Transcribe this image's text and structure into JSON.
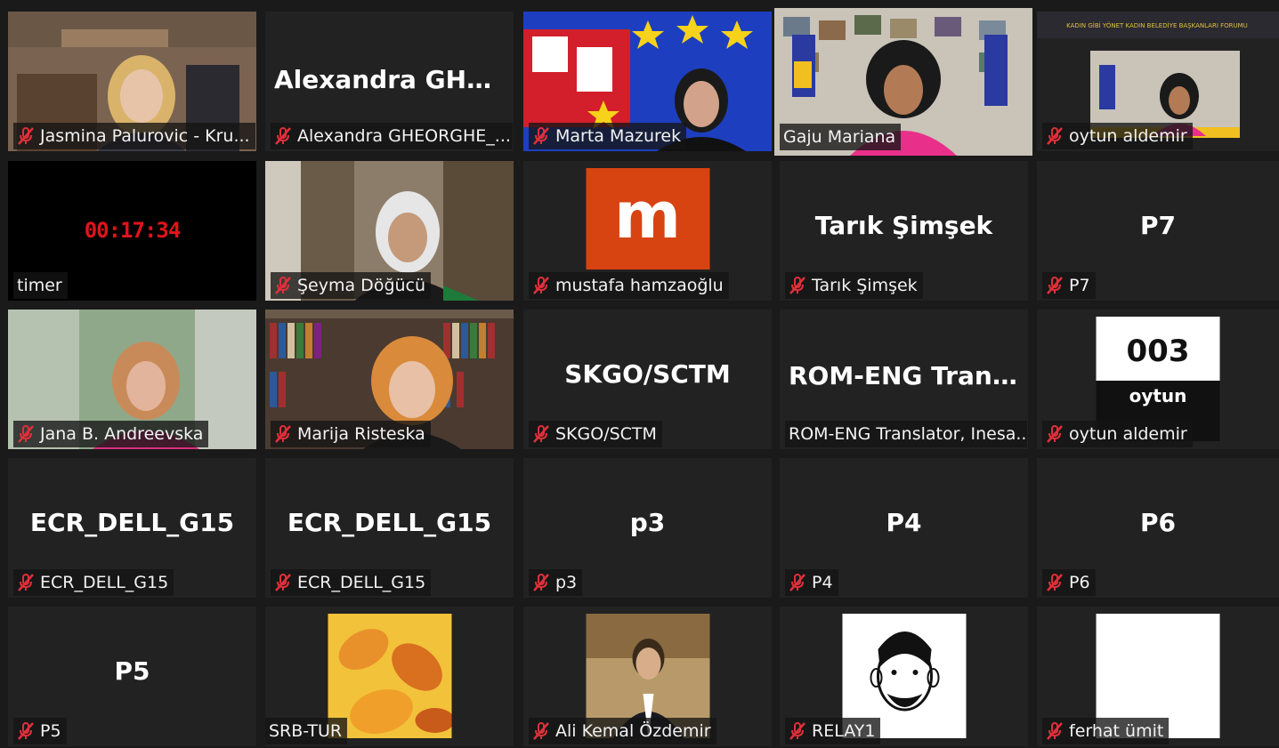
{
  "colors": {
    "background": "#1a1a1a",
    "tile": "#222222",
    "active_border": "#e3e07a",
    "mute_icon": "#e0303a",
    "timer_red": "#e0141a",
    "avatar_orange": "#d84312"
  },
  "tiles": [
    {
      "label": "Jasmina Palurovic - Kru...",
      "muted": true
    },
    {
      "label": "Alexandra GHEORGHE_...",
      "big": "Alexandra  GHE...",
      "muted": true
    },
    {
      "label": "Marta Mazurek",
      "muted": true
    },
    {
      "label": "Gaju Mariana",
      "muted": false,
      "active": true
    },
    {
      "label": "oytun aldemir",
      "muted": true
    },
    {
      "label": "timer",
      "timer": "00:17:34",
      "muted": false
    },
    {
      "label": "Şeyma Döğücü",
      "muted": true
    },
    {
      "label": "mustafa hamzaoğlu",
      "avatar_letter": "m",
      "muted": true
    },
    {
      "label": "Tarık Şimşek",
      "big": "Tarık Şimşek",
      "muted": true
    },
    {
      "label": "P7",
      "big": "P7",
      "muted": true
    },
    {
      "label": "Jana B. Andreevska",
      "muted": true
    },
    {
      "label": "Marija Risteska",
      "muted": true
    },
    {
      "label": "SKGO/SCTM",
      "big": "SKGO/SCTM",
      "muted": true
    },
    {
      "label": "ROM-ENG Translator, Inesa...",
      "big": "ROM-ENG  Tran...",
      "muted": false
    },
    {
      "label": "oytun aldemir",
      "box_number": "003",
      "box_name": "oytun",
      "muted": true
    },
    {
      "label": "ECR_DELL_G15",
      "big": "ECR_DELL_G15",
      "muted": true
    },
    {
      "label": "ECR_DELL_G15",
      "big": "ECR_DELL_G15",
      "muted": true
    },
    {
      "label": "p3",
      "big": "p3",
      "muted": true
    },
    {
      "label": "P4",
      "big": "P4",
      "muted": true
    },
    {
      "label": "P6",
      "big": "P6",
      "muted": true
    },
    {
      "label": "P5",
      "big": "P5",
      "muted": true
    },
    {
      "label": "SRB-TUR",
      "muted": false
    },
    {
      "label": "Ali Kemal Özdemir",
      "muted": true
    },
    {
      "label": "RELAY1",
      "muted": true
    },
    {
      "label": "ferhat ümit",
      "muted": true
    }
  ]
}
